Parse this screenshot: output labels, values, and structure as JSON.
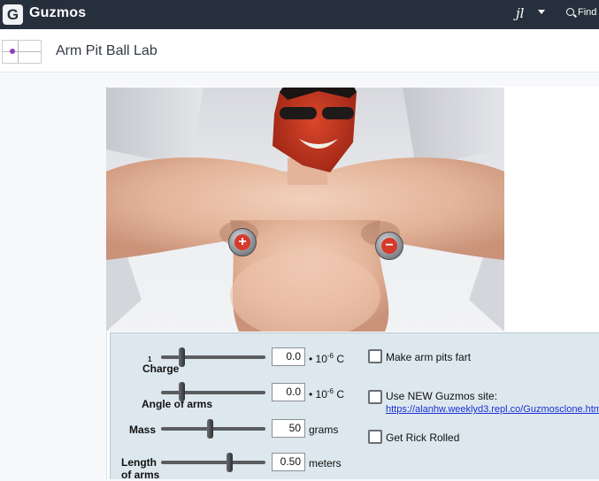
{
  "app": {
    "brand": "Guzmos",
    "logo_letter": "G",
    "user_initials": "jl",
    "find_label": "Find"
  },
  "lab": {
    "title": "Arm Pit Ball Lab"
  },
  "scene": {
    "plus_ball": "+",
    "minus_ball": "−"
  },
  "controls": {
    "charge": {
      "label": "Charge",
      "tick": "1",
      "value": "0.0",
      "unit_prefix": "• 10",
      "unit_exp": "-6",
      "unit_suffix": "C",
      "slider_fraction": 0.2
    },
    "angle": {
      "label": "Angle of arms",
      "value": "0.0",
      "unit_prefix": "• 10",
      "unit_exp": "-6",
      "unit_suffix": "C",
      "slider_fraction": 0.2
    },
    "mass": {
      "label": "Mass",
      "value": "50",
      "unit": "grams",
      "slider_fraction": 0.47
    },
    "length": {
      "label": "Length of arms",
      "value": "0.50",
      "unit": "meters",
      "slider_fraction": 0.67
    }
  },
  "options": {
    "fart": "Make arm pits fart",
    "new_site": "Use NEW Guzmos site:",
    "new_site_url": "https://alanhw.weeklyd3.repl.co/Guzmosclone.html",
    "rick": "Get Rick Rolled"
  }
}
